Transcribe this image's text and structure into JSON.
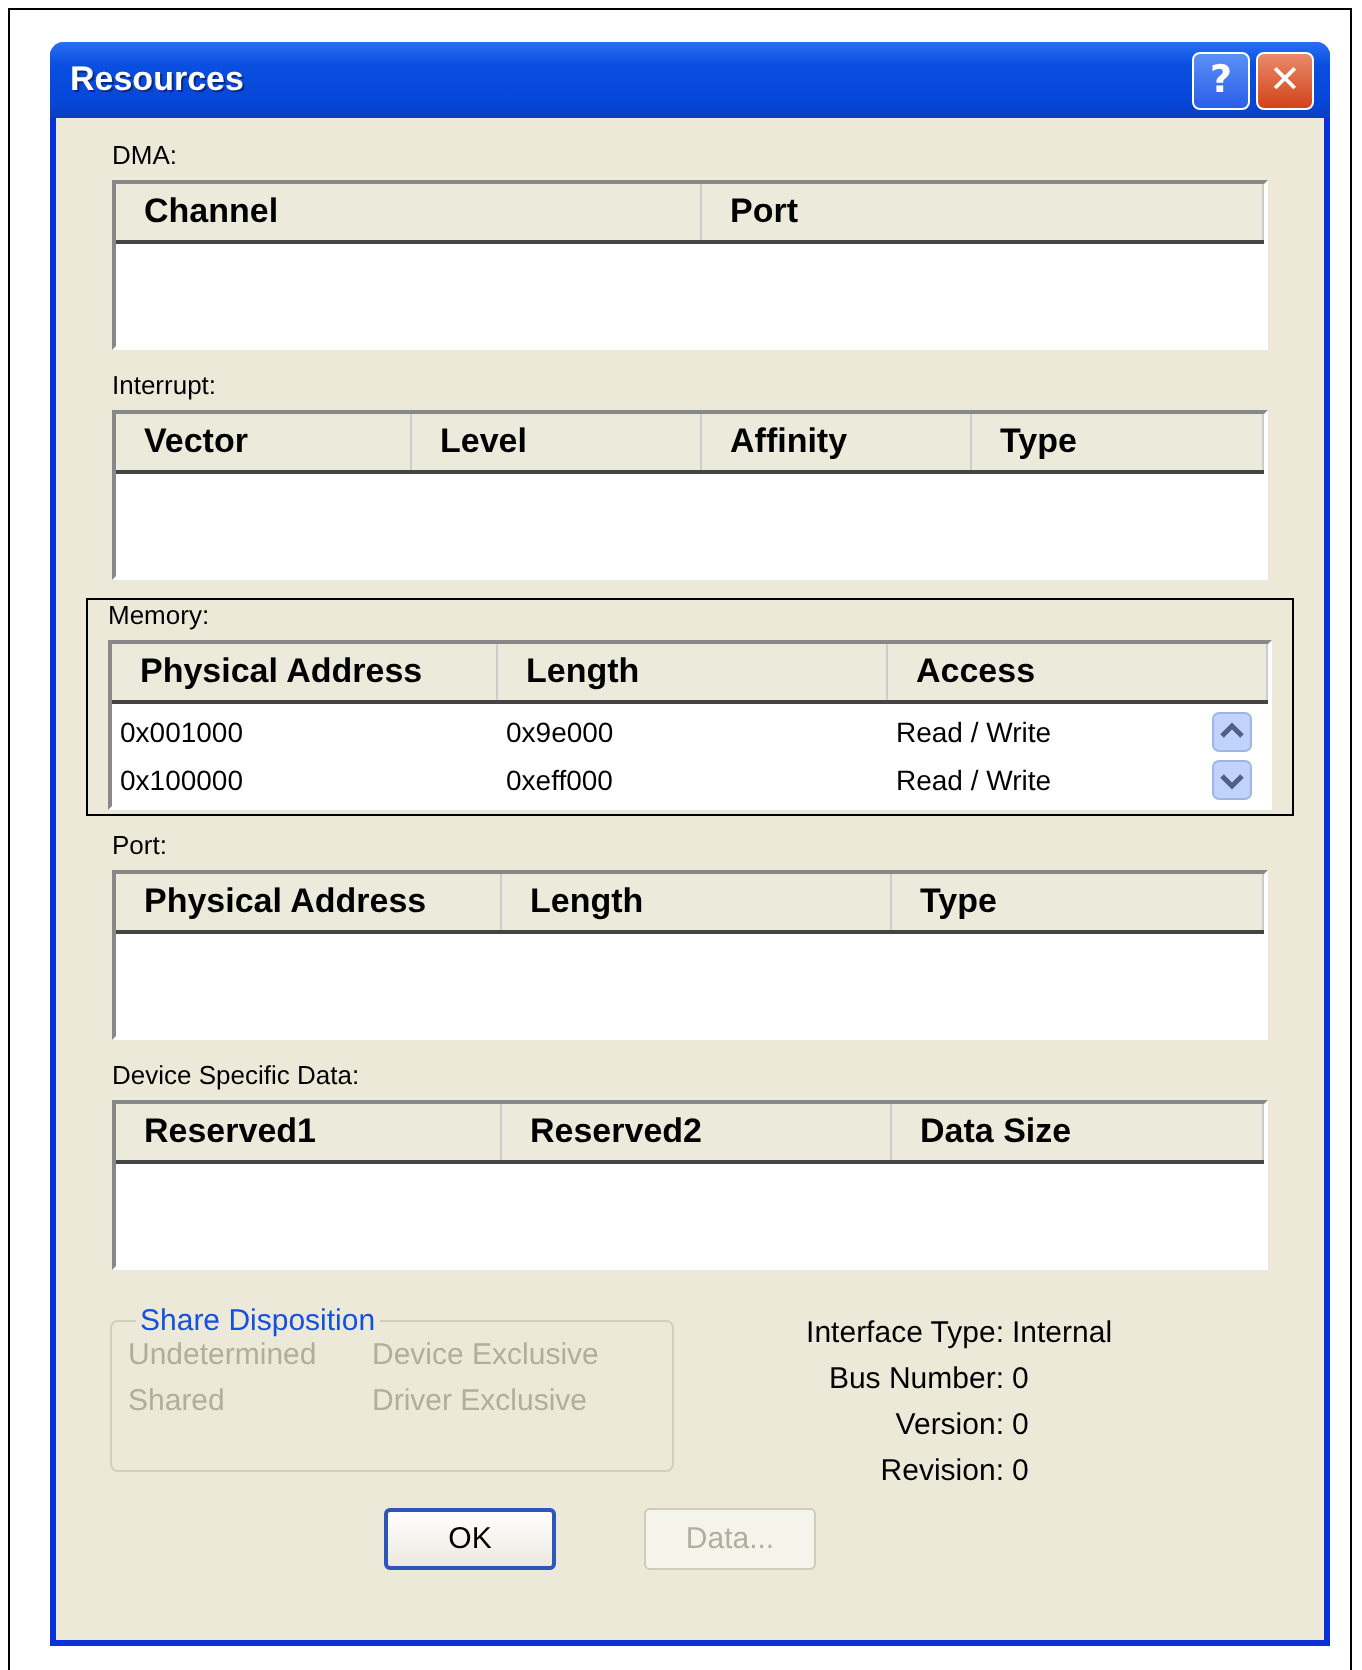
{
  "window": {
    "title": "Resources",
    "buttons": [
      "?",
      "✕"
    ]
  },
  "sections": [
    {
      "label": "DMA:",
      "highlighted": false,
      "columns": [
        "Channel",
        "Port"
      ],
      "scrollbar": false
    },
    {
      "label": "Interrupt:",
      "highlighted": false,
      "columns": [
        "Vector",
        "Level",
        "Affinity",
        "Type"
      ],
      "scrollbar": false
    },
    {
      "label": "Memory:",
      "highlighted": true,
      "columns": [
        "Physical Address",
        "Length",
        "Access"
      ],
      "rows": [
        [
          "0x001000",
          "0x9e000",
          "Read / Write"
        ],
        [
          "0x100000",
          "0xeff000",
          "Read / Write"
        ]
      ],
      "scrollbar": true
    },
    {
      "label": "Port:",
      "highlighted": false,
      "columns": [
        "Physical Address",
        "Length",
        "Type"
      ],
      "scrollbar": false
    },
    {
      "label": "Device Specific Data:",
      "highlighted": false,
      "columns": [
        "Reserved1",
        "Reserved2",
        "Data Size"
      ],
      "scrollbar": false
    }
  ],
  "share_disposition": {
    "title": "Share Disposition",
    "options": [
      {
        "label": "Undetermined",
        "disabled": true
      },
      {
        "label": "Device Exclusive",
        "disabled": true
      },
      {
        "label": "Shared",
        "disabled": true
      },
      {
        "label": "Driver Exclusive",
        "disabled": true
      }
    ]
  },
  "info": [
    {
      "label": "Interface Type:",
      "value": "Internal"
    },
    {
      "label": "Bus Number:",
      "value": "0"
    },
    {
      "label": "Version:",
      "value": "0"
    },
    {
      "label": "Revision:",
      "value": "0"
    }
  ],
  "buttons": [
    {
      "label": "OK",
      "disabled": false,
      "default": true
    },
    {
      "label": "Data...",
      "disabled": true,
      "default": false
    }
  ]
}
